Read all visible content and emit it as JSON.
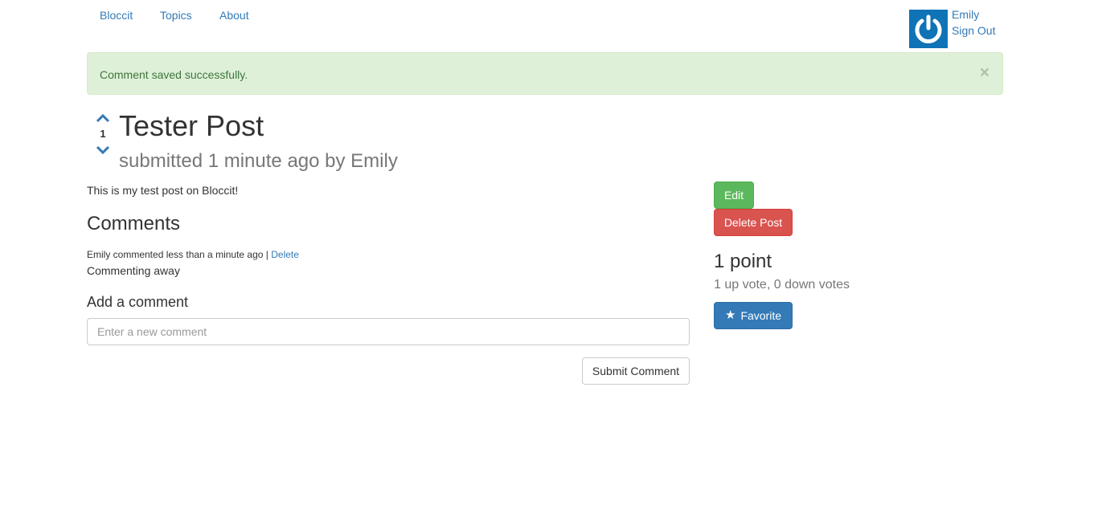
{
  "nav": {
    "links": [
      "Bloccit",
      "Topics",
      "About"
    ],
    "user_name": "Emily",
    "sign_out": "Sign Out",
    "avatar_icon": "power-icon",
    "avatar_color": "#0f73b6"
  },
  "alert": {
    "message": "Comment saved successfully.",
    "close": "×"
  },
  "post": {
    "vote_count": "1",
    "title": "Tester Post",
    "subtitle": "submitted 1 minute ago by Emily",
    "body": "This is my test post on Bloccit!"
  },
  "comments": {
    "heading": "Comments",
    "items": [
      {
        "meta": "Emily commented less than a minute ago |",
        "delete_label": "Delete",
        "body": "Commenting away"
      }
    ],
    "add_heading": "Add a comment",
    "input_placeholder": "Enter a new comment",
    "submit_label": "Submit Comment"
  },
  "sidebar": {
    "edit_label": "Edit",
    "delete_label": "Delete Post",
    "points": "1 point",
    "votes_detail": "1 up vote, 0 down votes",
    "favorite_icon": "★",
    "favorite_label": "Favorite"
  },
  "colors": {
    "link": "#337ab7",
    "success_bg": "#dff0d8",
    "success_text": "#3c763d",
    "edit": "#5cb85c",
    "danger": "#d9534f",
    "primary": "#337ab7"
  }
}
